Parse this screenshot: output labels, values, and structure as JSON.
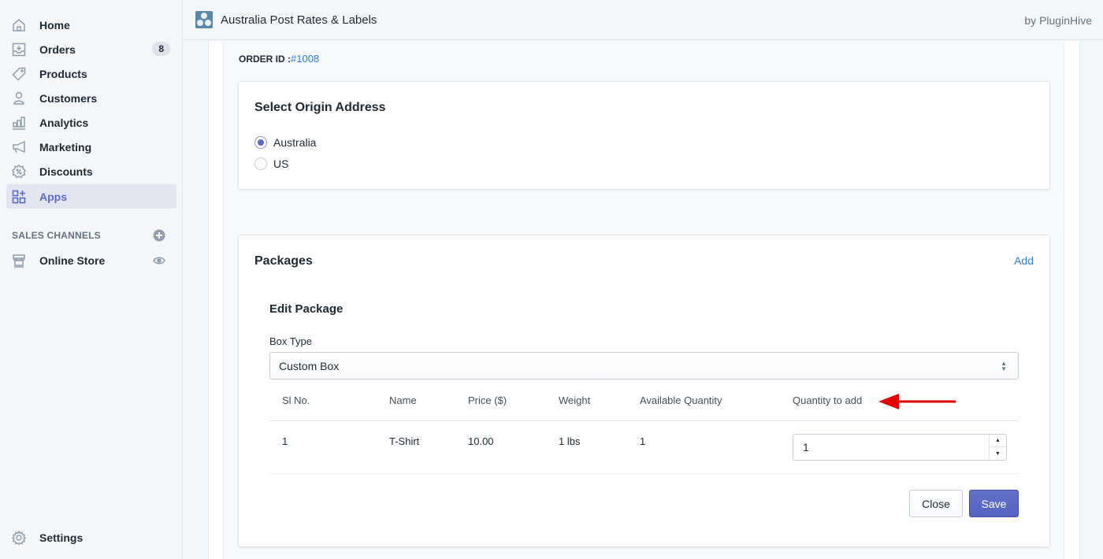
{
  "sidebar": {
    "items": [
      {
        "label": "Home",
        "icon": "home-icon"
      },
      {
        "label": "Orders",
        "icon": "orders-icon",
        "badge": "8"
      },
      {
        "label": "Products",
        "icon": "tag-icon"
      },
      {
        "label": "Customers",
        "icon": "person-icon"
      },
      {
        "label": "Analytics",
        "icon": "bar-chart-icon"
      },
      {
        "label": "Marketing",
        "icon": "megaphone-icon"
      },
      {
        "label": "Discounts",
        "icon": "discount-icon"
      },
      {
        "label": "Apps",
        "icon": "apps-icon",
        "active": true
      }
    ],
    "sales_channels_heading": "SALES CHANNELS",
    "online_store_label": "Online Store",
    "settings_label": "Settings"
  },
  "topbar": {
    "app_title": "Australia Post Rates & Labels",
    "by_label": "by PluginHive"
  },
  "order": {
    "label": "ORDER ID :",
    "id": "#1008"
  },
  "origin": {
    "title": "Select Origin Address",
    "options": [
      {
        "label": "Australia",
        "selected": true
      },
      {
        "label": "US",
        "selected": false
      }
    ]
  },
  "packages": {
    "title": "Packages",
    "add_label": "Add",
    "edit_title": "Edit Package",
    "box_type_label": "Box Type",
    "box_type_value": "Custom Box",
    "columns": [
      "Sl No.",
      "Name",
      "Price ($)",
      "Weight",
      "Available Quantity",
      "Quantity to add"
    ],
    "rows": [
      {
        "sl": "1",
        "name": "T-Shirt",
        "price": "10.00",
        "weight": "1 lbs",
        "available": "1",
        "quantity_to_add": "1"
      }
    ],
    "close_label": "Close",
    "save_label": "Save"
  },
  "colors": {
    "accent": "#5c6ac4",
    "link": "#2c7be5",
    "annotation_arrow": "#e00000"
  }
}
